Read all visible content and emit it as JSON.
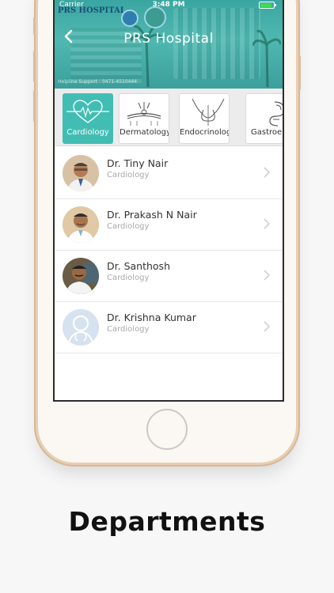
{
  "status_bar": {
    "carrier": "Carrier",
    "time": "3:48 PM"
  },
  "header": {
    "brand": "PRS HOSPITAL",
    "title": "PRS Hospital",
    "support": "Helpline Support : 0471-4510444",
    "back_icon": "chevron-left-icon"
  },
  "departments": [
    {
      "label": "Cardiology",
      "icon": "heart-icon",
      "active": true
    },
    {
      "label": "Dermatology",
      "icon": "skin-icon",
      "active": false
    },
    {
      "label": "Endocrinology",
      "icon": "thyroid-icon",
      "active": false
    },
    {
      "label": "Gastroenterology",
      "icon": "intestine-icon",
      "active": false
    }
  ],
  "doctors": [
    {
      "name": "Dr. Tiny Nair",
      "department": "Cardiology"
    },
    {
      "name": "Dr. Prakash N Nair",
      "department": "Cardiology"
    },
    {
      "name": "Dr. Santhosh",
      "department": "Cardiology"
    },
    {
      "name": "Dr. Krishna Kumar",
      "department": "Cardiology"
    }
  ],
  "caption": "Departments",
  "colors": {
    "accent": "#42bdb4",
    "header": "#3aa6a1"
  }
}
